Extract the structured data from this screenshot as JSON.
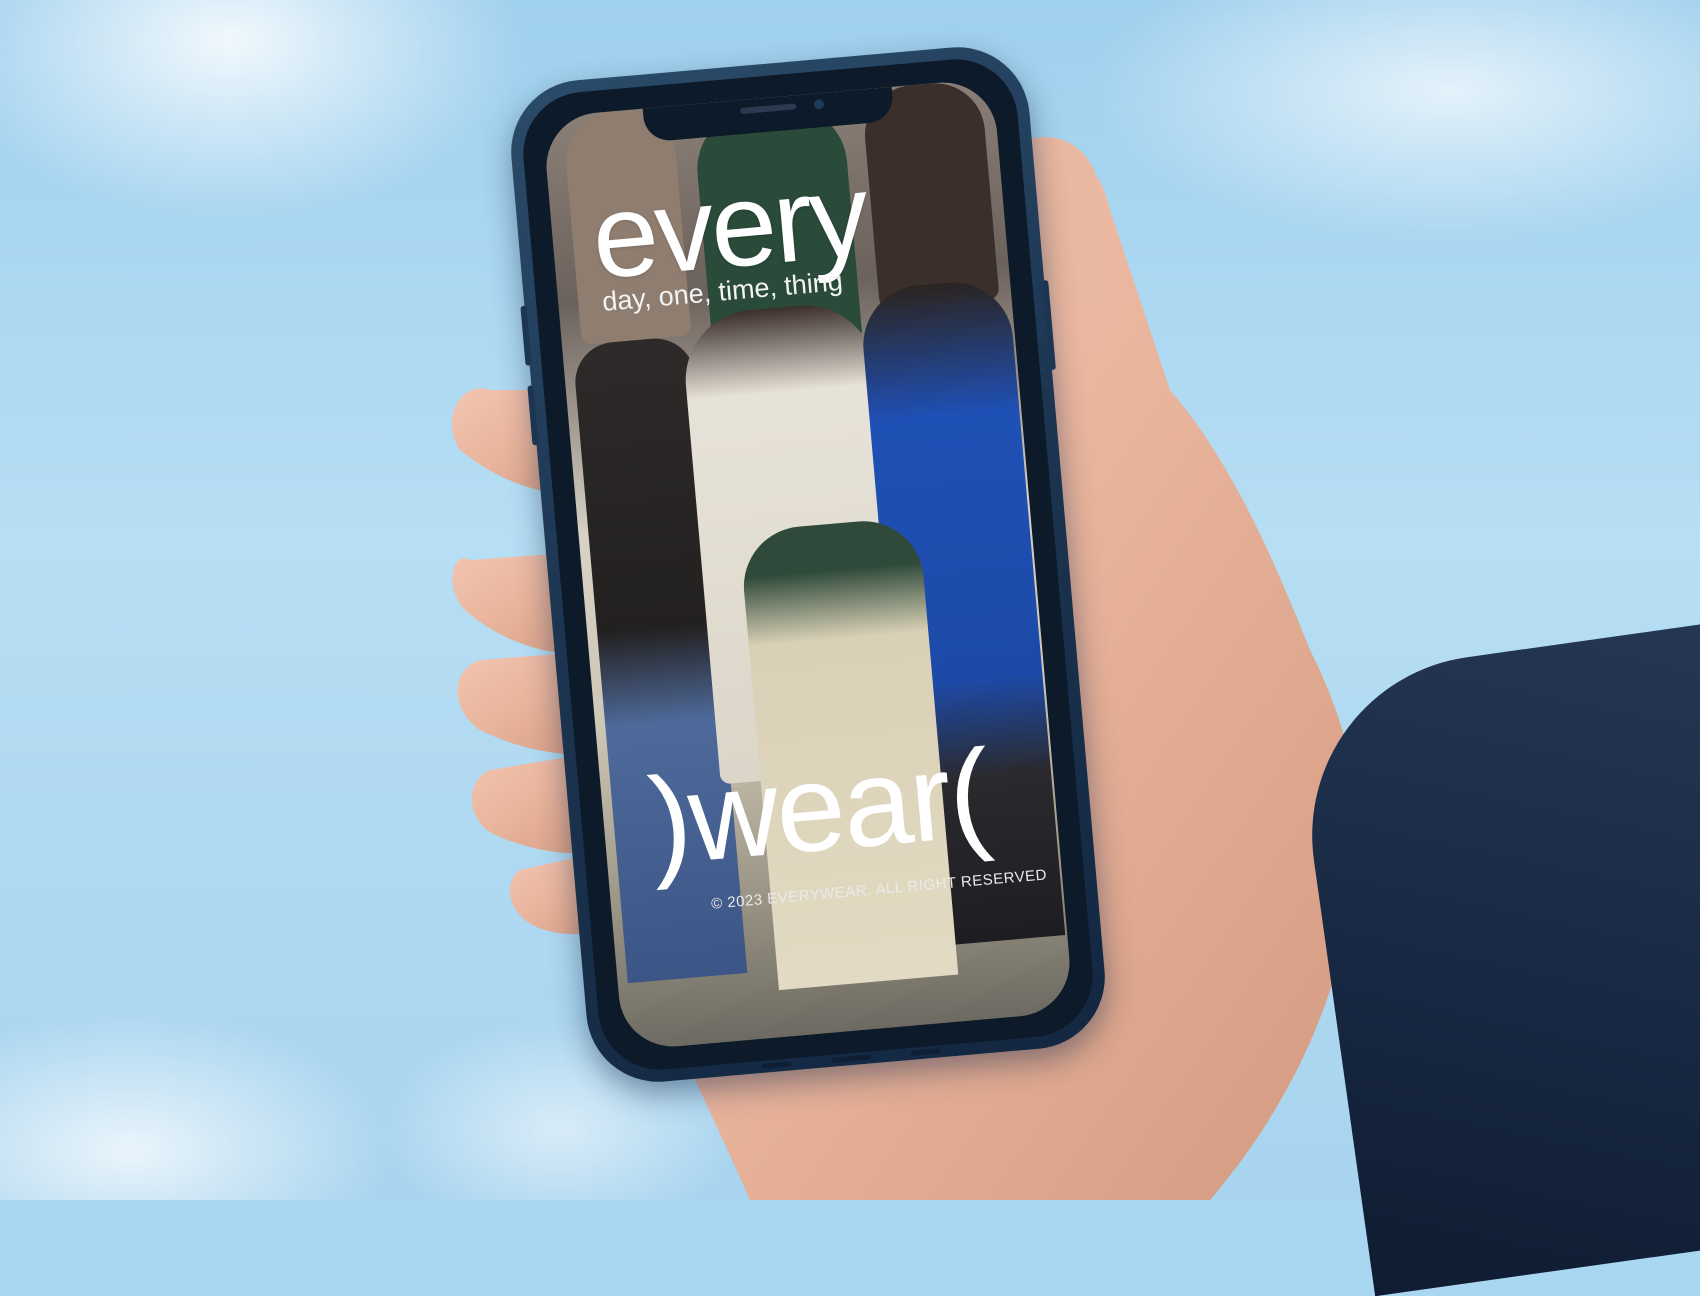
{
  "screen": {
    "wordmark_top": "every",
    "tagline": "day, one, time, thing",
    "wordmark_bottom": ")wear(",
    "copyright": "© 2023 EVERYWEAR. ALL RIGHT RESERVED"
  },
  "colors": {
    "sky": "#a9d6f0",
    "phone_frame": "#1b3450",
    "sleeve": "#172741",
    "wordmark": "#ffffff"
  }
}
